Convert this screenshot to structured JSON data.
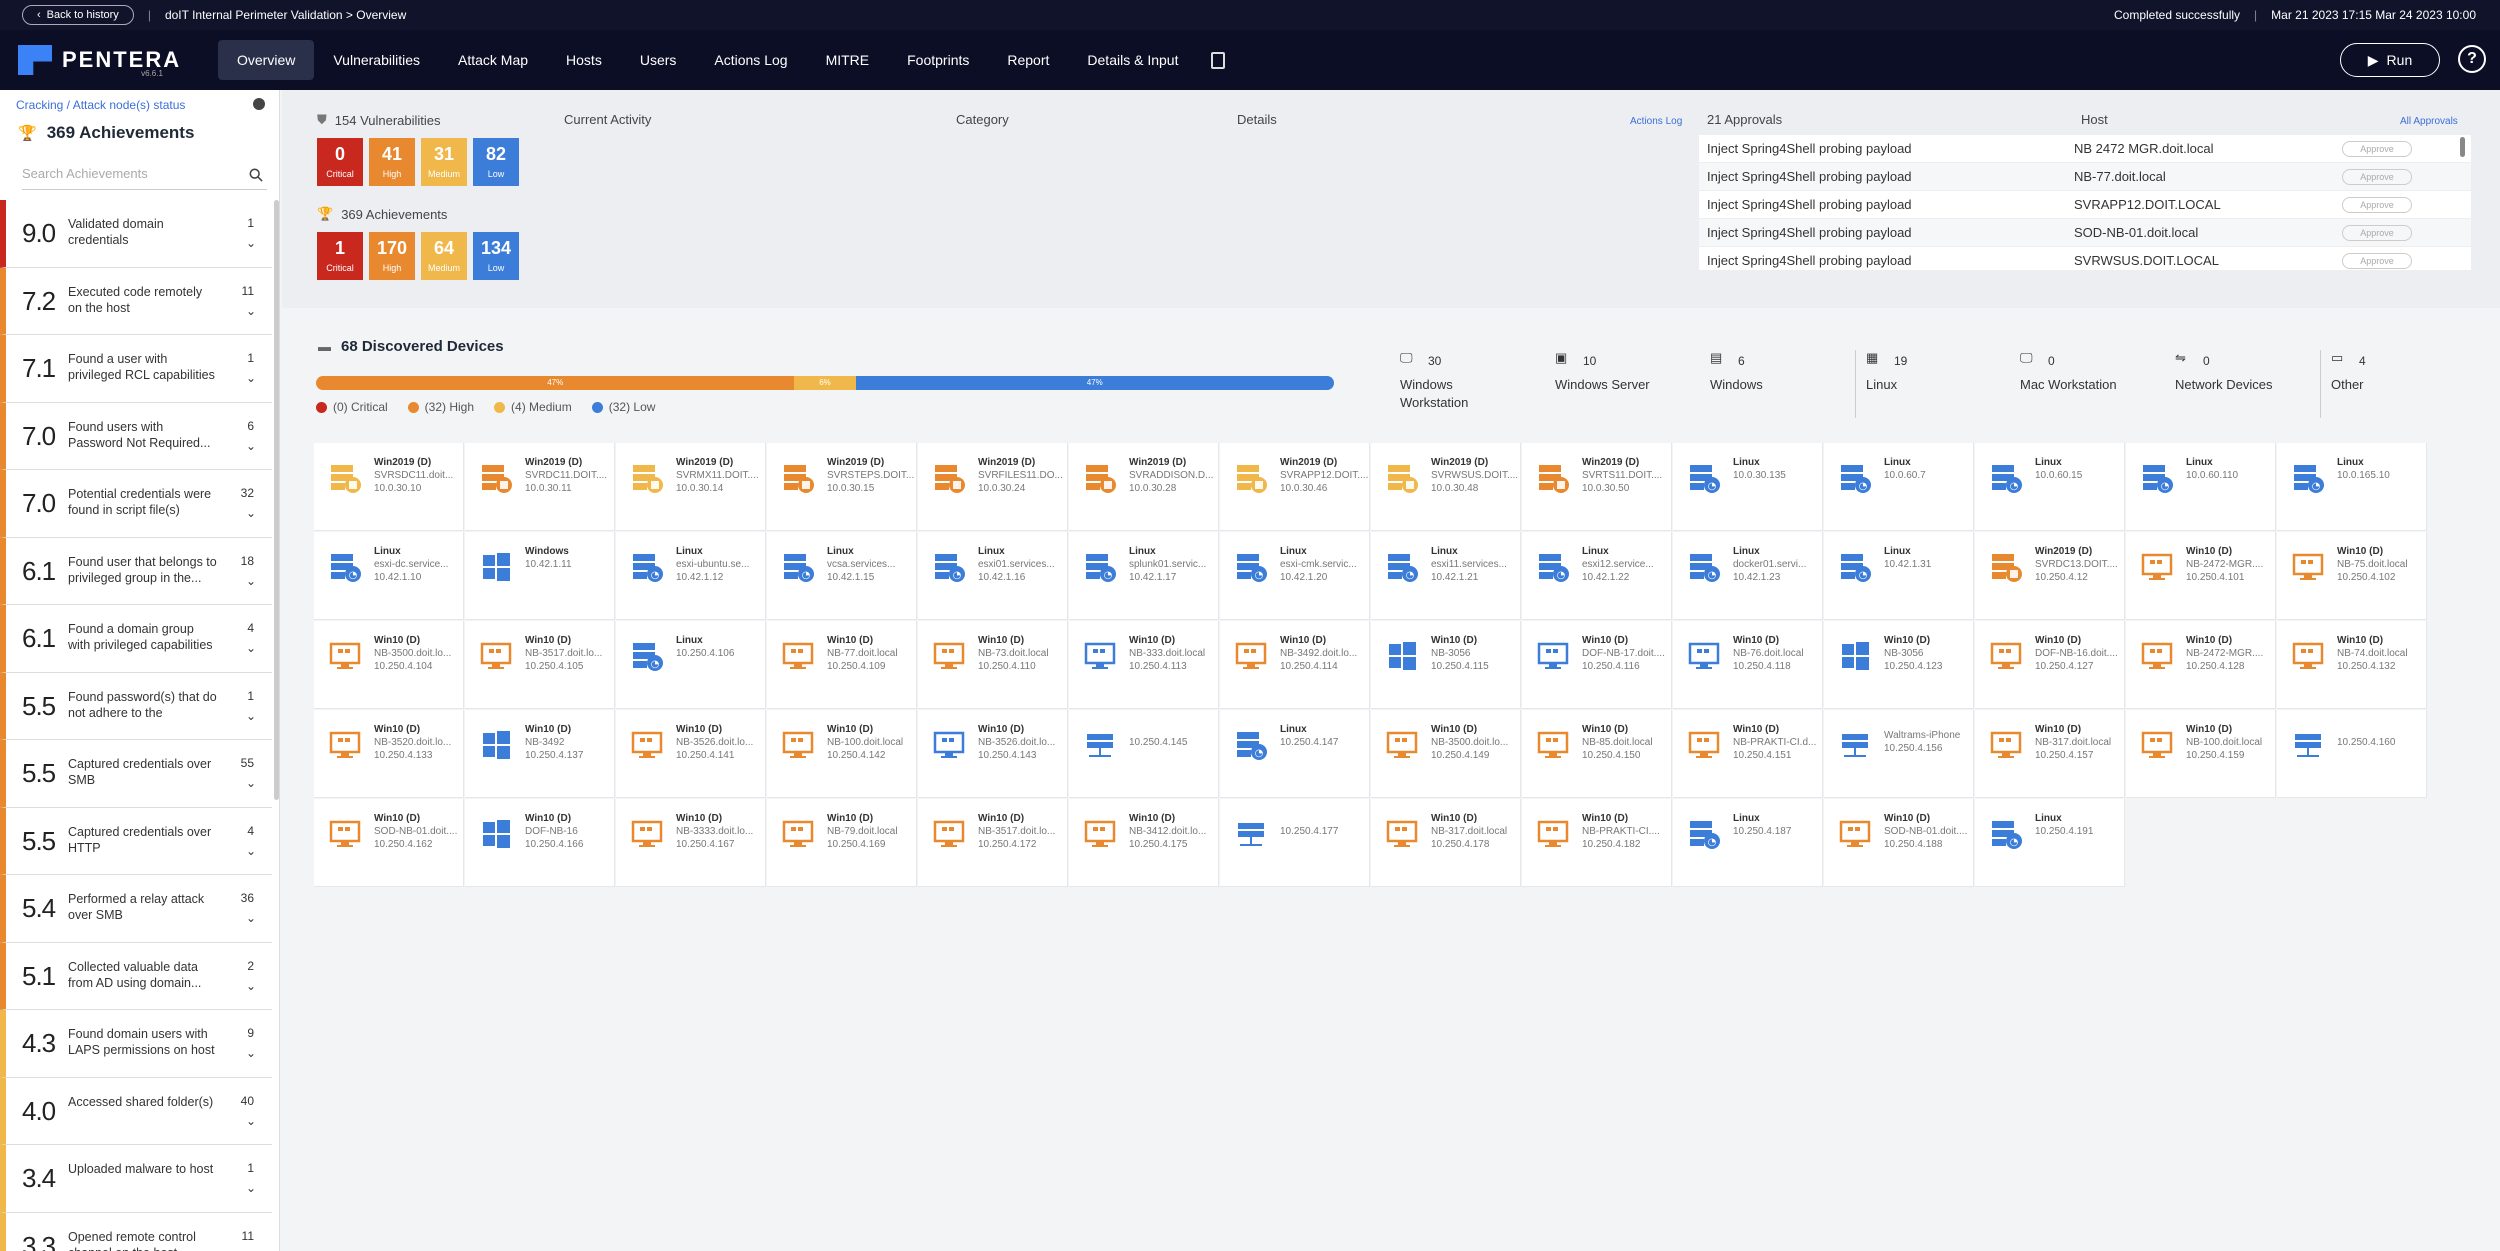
{
  "topbar": {
    "back_label": "Back to history",
    "breadcrumb": "doIT Internal Perimeter Validation > Overview",
    "status": "Completed successfully",
    "dates": "Mar 21 2023 17:15 Mar 24 2023 10:00"
  },
  "nav": {
    "logo": "PENTERA",
    "logo_version": "v6.6.1",
    "items": [
      "Overview",
      "Vulnerabilities",
      "Attack Map",
      "Hosts",
      "Users",
      "Actions Log",
      "MITRE",
      "Footprints",
      "Report",
      "Details & Input"
    ],
    "active": "Overview",
    "run_label": "Run",
    "help": "?"
  },
  "sidebar": {
    "breadcrumb": "Cracking / Attack node(s) status",
    "title": "369 Achievements",
    "search_placeholder": "Search Achievements",
    "items": [
      {
        "score": "9.0",
        "text": "Validated domain credentials",
        "count": "1",
        "color": "#c8281e"
      },
      {
        "score": "7.2",
        "text": "Executed code remotely on the host",
        "count": "11",
        "color": "#e8892f"
      },
      {
        "score": "7.1",
        "text": "Found a user with privileged RCL capabilities",
        "count": "1",
        "color": "#e8892f"
      },
      {
        "score": "7.0",
        "text": "Found users with Password Not Required...",
        "count": "6",
        "color": "#e8892f"
      },
      {
        "score": "7.0",
        "text": "Potential credentials were found in script file(s)",
        "count": "32",
        "color": "#e8892f"
      },
      {
        "score": "6.1",
        "text": "Found user that belongs to privileged group in the...",
        "count": "18",
        "color": "#e8892f"
      },
      {
        "score": "6.1",
        "text": "Found a domain group with privileged capabilities on...",
        "count": "4",
        "color": "#e8892f"
      },
      {
        "score": "5.5",
        "text": "Found password(s) that do not adhere to the passwor...",
        "count": "1",
        "color": "#e8892f"
      },
      {
        "score": "5.5",
        "text": "Captured credentials over SMB",
        "count": "55",
        "color": "#e8892f"
      },
      {
        "score": "5.5",
        "text": "Captured credentials over HTTP",
        "count": "4",
        "color": "#e8892f"
      },
      {
        "score": "5.4",
        "text": "Performed a relay attack over SMB",
        "count": "36",
        "color": "#e8892f"
      },
      {
        "score": "5.1",
        "text": "Collected valuable data from AD using domain...",
        "count": "2",
        "color": "#e8892f"
      },
      {
        "score": "4.3",
        "text": "Found domain users with LAPS permissions on host",
        "count": "9",
        "color": "#f0b84a"
      },
      {
        "score": "4.0",
        "text": "Accessed shared folder(s)",
        "count": "40",
        "color": "#f0b84a"
      },
      {
        "score": "3.4",
        "text": "Uploaded malware to host",
        "count": "1",
        "color": "#f0b84a"
      },
      {
        "score": "3.3",
        "text": "Opened remote control channel on the host",
        "count": "11",
        "color": "#f0b84a"
      }
    ]
  },
  "summary": {
    "vuln_title": "154 Vulnerabilities",
    "vuln": [
      {
        "n": "0",
        "l": "Critical",
        "c": "#c8281e"
      },
      {
        "n": "41",
        "l": "High",
        "c": "#e8892f"
      },
      {
        "n": "31",
        "l": "Medium",
        "c": "#f0b84a"
      },
      {
        "n": "82",
        "l": "Low",
        "c": "#3b7dd8"
      }
    ],
    "ach_title": "369 Achievements",
    "ach": [
      {
        "n": "1",
        "l": "Critical",
        "c": "#c8281e"
      },
      {
        "n": "170",
        "l": "High",
        "c": "#e8892f"
      },
      {
        "n": "64",
        "l": "Medium",
        "c": "#f0b84a"
      },
      {
        "n": "134",
        "l": "Low",
        "c": "#3b7dd8"
      }
    ],
    "col_current": "Current Activity",
    "col_category": "Category",
    "col_details": "Details",
    "actions_log_link": "Actions Log",
    "approvals_title": "21 Approvals",
    "host_col": "Host",
    "all_approvals": "All Approvals",
    "approve_label": "Approve",
    "approvals": [
      {
        "name": "Inject Spring4Shell probing payload",
        "host": "NB 2472 MGR.doit.local"
      },
      {
        "name": "Inject Spring4Shell probing payload",
        "host": "NB-77.doit.local"
      },
      {
        "name": "Inject Spring4Shell probing payload",
        "host": "SVRAPP12.DOIT.LOCAL"
      },
      {
        "name": "Inject Spring4Shell probing payload",
        "host": "SOD-NB-01.doit.local"
      },
      {
        "name": "Inject Spring4Shell probing payload",
        "host": "SVRWSUS.DOIT.LOCAL"
      }
    ]
  },
  "devices": {
    "title": "68 Discovered Devices",
    "bar": [
      {
        "pct": 47,
        "label": "47%",
        "c": "#e8892f"
      },
      {
        "pct": 6,
        "label": "6%",
        "c": "#f0b84a"
      },
      {
        "pct": 47,
        "label": "47%",
        "c": "#3b7dd8"
      }
    ],
    "legend": [
      {
        "t": "(0) Critical",
        "c": "#c8281e"
      },
      {
        "t": "(32) High",
        "c": "#e8892f"
      },
      {
        "t": "(4) Medium",
        "c": "#f0b84a"
      },
      {
        "t": "(32) Low",
        "c": "#3b7dd8"
      }
    ],
    "categories": [
      {
        "n": "30",
        "l": "Windows Workstation",
        "icon": "workstation-icon"
      },
      {
        "n": "10",
        "l": "Windows Server",
        "icon": "server-icon"
      },
      {
        "n": "6",
        "l": "Windows",
        "icon": "windows-icon"
      },
      {
        "n": "19",
        "l": "Linux",
        "icon": "linux-icon"
      },
      {
        "n": "0",
        "l": "Mac Workstation",
        "icon": "mac-icon"
      },
      {
        "n": "0",
        "l": "Network Devices",
        "icon": "network-icon"
      },
      {
        "n": "4",
        "l": "Other",
        "icon": "other-icon"
      }
    ],
    "hosts": [
      {
        "os": "Win2019 (D)",
        "h": "SVRSDC11.doit...",
        "ip": "10.0.30.10",
        "t": "srv",
        "c": "#f0b84a"
      },
      {
        "os": "Win2019 (D)",
        "h": "SVRDC11.DOIT....",
        "ip": "10.0.30.11",
        "t": "srv",
        "c": "#e8892f"
      },
      {
        "os": "Win2019 (D)",
        "h": "SVRMX11.DOIT....",
        "ip": "10.0.30.14",
        "t": "srv",
        "c": "#f0b84a"
      },
      {
        "os": "Win2019 (D)",
        "h": "SVRSTEPS.DOIT....",
        "ip": "10.0.30.15",
        "t": "srv",
        "c": "#e8892f"
      },
      {
        "os": "Win2019 (D)",
        "h": "SVRFILES11.DO...",
        "ip": "10.0.30.24",
        "t": "srv",
        "c": "#e8892f"
      },
      {
        "os": "Win2019 (D)",
        "h": "SVRADDISON.D...",
        "ip": "10.0.30.28",
        "t": "srv",
        "c": "#e8892f"
      },
      {
        "os": "Win2019 (D)",
        "h": "SVRAPP12.DOIT....",
        "ip": "10.0.30.46",
        "t": "srv",
        "c": "#f0b84a"
      },
      {
        "os": "Win2019 (D)",
        "h": "SVRWSUS.DOIT....",
        "ip": "10.0.30.48",
        "t": "srv",
        "c": "#f0b84a"
      },
      {
        "os": "Win2019 (D)",
        "h": "SVRTS11.DOIT....",
        "ip": "10.0.30.50",
        "t": "srv",
        "c": "#e8892f"
      },
      {
        "os": "Linux",
        "h": "",
        "ip": "10.0.30.135",
        "t": "lin",
        "c": "#3b7dd8"
      },
      {
        "os": "Linux",
        "h": "",
        "ip": "10.0.60.7",
        "t": "lin",
        "c": "#3b7dd8"
      },
      {
        "os": "Linux",
        "h": "",
        "ip": "10.0.60.15",
        "t": "lin",
        "c": "#3b7dd8"
      },
      {
        "os": "Linux",
        "h": "",
        "ip": "10.0.60.110",
        "t": "lin",
        "c": "#3b7dd8"
      },
      {
        "os": "Linux",
        "h": "",
        "ip": "10.0.165.10",
        "t": "lin",
        "c": "#3b7dd8"
      },
      {
        "os": "Linux",
        "h": "esxi-dc.service...",
        "ip": "10.42.1.10",
        "t": "lin",
        "c": "#3b7dd8"
      },
      {
        "os": "Windows",
        "h": "",
        "ip": "10.42.1.11",
        "t": "win",
        "c": "#3b7dd8"
      },
      {
        "os": "Linux",
        "h": "esxi-ubuntu.se...",
        "ip": "10.42.1.12",
        "t": "lin",
        "c": "#3b7dd8"
      },
      {
        "os": "Linux",
        "h": "vcsa.services...",
        "ip": "10.42.1.15",
        "t": "lin",
        "c": "#3b7dd8"
      },
      {
        "os": "Linux",
        "h": "esxi01.services...",
        "ip": "10.42.1.16",
        "t": "lin",
        "c": "#3b7dd8"
      },
      {
        "os": "Linux",
        "h": "splunk01.servic...",
        "ip": "10.42.1.17",
        "t": "lin",
        "c": "#3b7dd8"
      },
      {
        "os": "Linux",
        "h": "esxi-cmk.servic...",
        "ip": "10.42.1.20",
        "t": "lin",
        "c": "#3b7dd8"
      },
      {
        "os": "Linux",
        "h": "esxi11.services...",
        "ip": "10.42.1.21",
        "t": "lin",
        "c": "#3b7dd8"
      },
      {
        "os": "Linux",
        "h": "esxi12.service...",
        "ip": "10.42.1.22",
        "t": "lin",
        "c": "#3b7dd8"
      },
      {
        "os": "Linux",
        "h": "docker01.servi...",
        "ip": "10.42.1.23",
        "t": "lin",
        "c": "#3b7dd8"
      },
      {
        "os": "Linux",
        "h": "",
        "ip": "10.42.1.31",
        "t": "lin",
        "c": "#3b7dd8"
      },
      {
        "os": "Win2019 (D)",
        "h": "SVRDC13.DOIT....",
        "ip": "10.250.4.12",
        "t": "srv",
        "c": "#e8892f"
      },
      {
        "os": "Win10 (D)",
        "h": "NB-2472-MGR....",
        "ip": "10.250.4.101",
        "t": "ws",
        "c": "#e8892f"
      },
      {
        "os": "Win10 (D)",
        "h": "NB-75.doit.local",
        "ip": "10.250.4.102",
        "t": "ws",
        "c": "#e8892f"
      },
      {
        "os": "Win10 (D)",
        "h": "NB-3500.doit.lo...",
        "ip": "10.250.4.104",
        "t": "ws",
        "c": "#e8892f"
      },
      {
        "os": "Win10 (D)",
        "h": "NB-3517.doit.lo...",
        "ip": "10.250.4.105",
        "t": "ws",
        "c": "#e8892f"
      },
      {
        "os": "Linux",
        "h": "",
        "ip": "10.250.4.106",
        "t": "lin",
        "c": "#3b7dd8"
      },
      {
        "os": "Win10 (D)",
        "h": "NB-77.doit.local",
        "ip": "10.250.4.109",
        "t": "ws",
        "c": "#e8892f"
      },
      {
        "os": "Win10 (D)",
        "h": "NB-73.doit.local",
        "ip": "10.250.4.110",
        "t": "ws",
        "c": "#e8892f"
      },
      {
        "os": "Win10 (D)",
        "h": "NB-333.doit.local",
        "ip": "10.250.4.113",
        "t": "ws",
        "c": "#3b7dd8"
      },
      {
        "os": "Win10 (D)",
        "h": "NB-3492.doit.lo...",
        "ip": "10.250.4.114",
        "t": "ws",
        "c": "#e8892f"
      },
      {
        "os": "Win10 (D)",
        "h": "NB-3056",
        "ip": "10.250.4.115",
        "t": "win",
        "c": "#3b7dd8"
      },
      {
        "os": "Win10 (D)",
        "h": "DOF-NB-17.doit....",
        "ip": "10.250.4.116",
        "t": "ws",
        "c": "#3b7dd8"
      },
      {
        "os": "Win10 (D)",
        "h": "NB-76.doit.local",
        "ip": "10.250.4.118",
        "t": "ws",
        "c": "#3b7dd8"
      },
      {
        "os": "Win10 (D)",
        "h": "NB-3056",
        "ip": "10.250.4.123",
        "t": "win",
        "c": "#3b7dd8"
      },
      {
        "os": "Win10 (D)",
        "h": "DOF-NB-16.doit....",
        "ip": "10.250.4.127",
        "t": "ws",
        "c": "#e8892f"
      },
      {
        "os": "Win10 (D)",
        "h": "NB-2472-MGR....",
        "ip": "10.250.4.128",
        "t": "ws",
        "c": "#e8892f"
      },
      {
        "os": "Win10 (D)",
        "h": "NB-74.doit.local",
        "ip": "10.250.4.132",
        "t": "ws",
        "c": "#e8892f"
      },
      {
        "os": "Win10 (D)",
        "h": "NB-3520.doit.lo...",
        "ip": "10.250.4.133",
        "t": "ws",
        "c": "#e8892f"
      },
      {
        "os": "Win10 (D)",
        "h": "NB-3492",
        "ip": "10.250.4.137",
        "t": "win",
        "c": "#3b7dd8"
      },
      {
        "os": "Win10 (D)",
        "h": "NB-3526.doit.lo...",
        "ip": "10.250.4.141",
        "t": "ws",
        "c": "#e8892f"
      },
      {
        "os": "Win10 (D)",
        "h": "NB-100.doit.local",
        "ip": "10.250.4.142",
        "t": "ws",
        "c": "#e8892f"
      },
      {
        "os": "Win10 (D)",
        "h": "NB-3526.doit.lo...",
        "ip": "10.250.4.143",
        "t": "ws",
        "c": "#3b7dd8"
      },
      {
        "os": "",
        "h": "",
        "ip": "10.250.4.145",
        "t": "net",
        "c": "#3b7dd8"
      },
      {
        "os": "Linux",
        "h": "",
        "ip": "10.250.4.147",
        "t": "lin",
        "c": "#3b7dd8"
      },
      {
        "os": "Win10 (D)",
        "h": "NB-3500.doit.lo...",
        "ip": "10.250.4.149",
        "t": "ws",
        "c": "#e8892f"
      },
      {
        "os": "Win10 (D)",
        "h": "NB-85.doit.local",
        "ip": "10.250.4.150",
        "t": "ws",
        "c": "#e8892f"
      },
      {
        "os": "Win10 (D)",
        "h": "NB-PRAKTI-CI.d...",
        "ip": "10.250.4.151",
        "t": "ws",
        "c": "#e8892f"
      },
      {
        "os": "",
        "h": "Waltrams-iPhone",
        "ip": "10.250.4.156",
        "t": "net",
        "c": "#3b7dd8"
      },
      {
        "os": "Win10 (D)",
        "h": "NB-317.doit.local",
        "ip": "10.250.4.157",
        "t": "ws",
        "c": "#e8892f"
      },
      {
        "os": "Win10 (D)",
        "h": "NB-100.doit.local",
        "ip": "10.250.4.159",
        "t": "ws",
        "c": "#e8892f"
      },
      {
        "os": "",
        "h": "",
        "ip": "10.250.4.160",
        "t": "net",
        "c": "#3b7dd8"
      },
      {
        "os": "Win10 (D)",
        "h": "SOD-NB-01.doit....",
        "ip": "10.250.4.162",
        "t": "ws",
        "c": "#e8892f"
      },
      {
        "os": "Win10 (D)",
        "h": "DOF-NB-16",
        "ip": "10.250.4.166",
        "t": "win",
        "c": "#3b7dd8"
      },
      {
        "os": "Win10 (D)",
        "h": "NB-3333.doit.lo...",
        "ip": "10.250.4.167",
        "t": "ws",
        "c": "#e8892f"
      },
      {
        "os": "Win10 (D)",
        "h": "NB-79.doit.local",
        "ip": "10.250.4.169",
        "t": "ws",
        "c": "#e8892f"
      },
      {
        "os": "Win10 (D)",
        "h": "NB-3517.doit.lo...",
        "ip": "10.250.4.172",
        "t": "ws",
        "c": "#e8892f"
      },
      {
        "os": "Win10 (D)",
        "h": "NB-3412.doit.lo...",
        "ip": "10.250.4.175",
        "t": "ws",
        "c": "#e8892f"
      },
      {
        "os": "",
        "h": "",
        "ip": "10.250.4.177",
        "t": "net",
        "c": "#3b7dd8"
      },
      {
        "os": "Win10 (D)",
        "h": "NB-317.doit.local",
        "ip": "10.250.4.178",
        "t": "ws",
        "c": "#e8892f"
      },
      {
        "os": "Win10 (D)",
        "h": "NB-PRAKTI-CI....",
        "ip": "10.250.4.182",
        "t": "ws",
        "c": "#e8892f"
      },
      {
        "os": "Linux",
        "h": "",
        "ip": "10.250.4.187",
        "t": "lin",
        "c": "#3b7dd8"
      },
      {
        "os": "Win10 (D)",
        "h": "SOD-NB-01.doit....",
        "ip": "10.250.4.188",
        "t": "ws",
        "c": "#e8892f"
      },
      {
        "os": "Linux",
        "h": "",
        "ip": "10.250.4.191",
        "t": "lin",
        "c": "#3b7dd8"
      }
    ]
  }
}
